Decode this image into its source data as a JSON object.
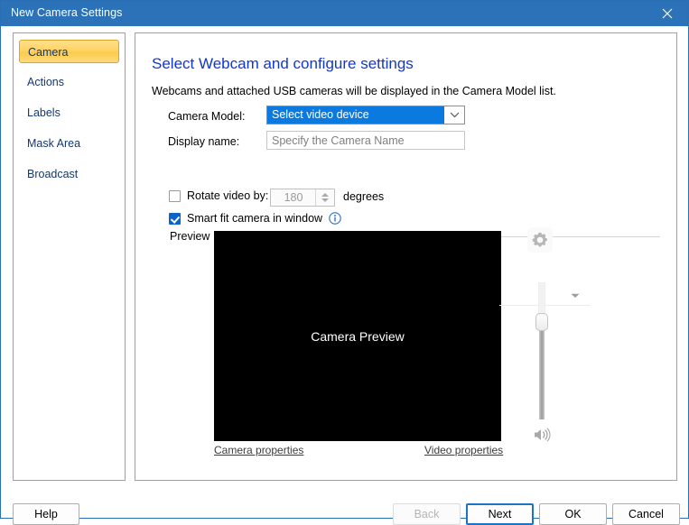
{
  "window": {
    "title": "New Camera Settings",
    "close_icon": "close-icon"
  },
  "sidebar": {
    "items": [
      {
        "label": "Camera",
        "selected": true
      },
      {
        "label": "Actions",
        "selected": false
      },
      {
        "label": "Labels",
        "selected": false
      },
      {
        "label": "Mask Area",
        "selected": false
      },
      {
        "label": "Broadcast",
        "selected": false
      }
    ]
  },
  "content": {
    "heading": "Select Webcam and configure settings",
    "description": "Webcams and attached USB cameras will be displayed in the Camera Model list.",
    "camera_model": {
      "label": "Camera Model:",
      "value": "Select video device",
      "arrow_icon": "chevron-down-icon"
    },
    "display_name": {
      "label": "Display name:",
      "value": "",
      "placeholder": "Specify the Camera Name"
    },
    "rotate": {
      "label": "Rotate video by:",
      "checked": false,
      "value": "180",
      "units": "degrees"
    },
    "smart_fit": {
      "label": "Smart fit camera in window",
      "checked": true,
      "info_icon": "info-icon"
    },
    "preview": {
      "group_label": "Preview",
      "placeholder_text": "Camera Preview"
    },
    "links": {
      "camera_properties": "Camera properties",
      "video_properties": "Video properties"
    },
    "device_controls": {
      "gear_icon": "gear-icon",
      "expand_icon": "chevron-down-icon",
      "volume_icon": "volume-icon",
      "slider_position_percent": 28
    }
  },
  "footer": {
    "help": "Help",
    "back": "Back",
    "next": "Next",
    "ok": "OK",
    "cancel": "Cancel"
  },
  "colors": {
    "titlebar": "#2b72b8",
    "accent_blue": "#0a7ae0",
    "heading_blue": "#1337cc",
    "selection_gold": "#ffd464"
  }
}
